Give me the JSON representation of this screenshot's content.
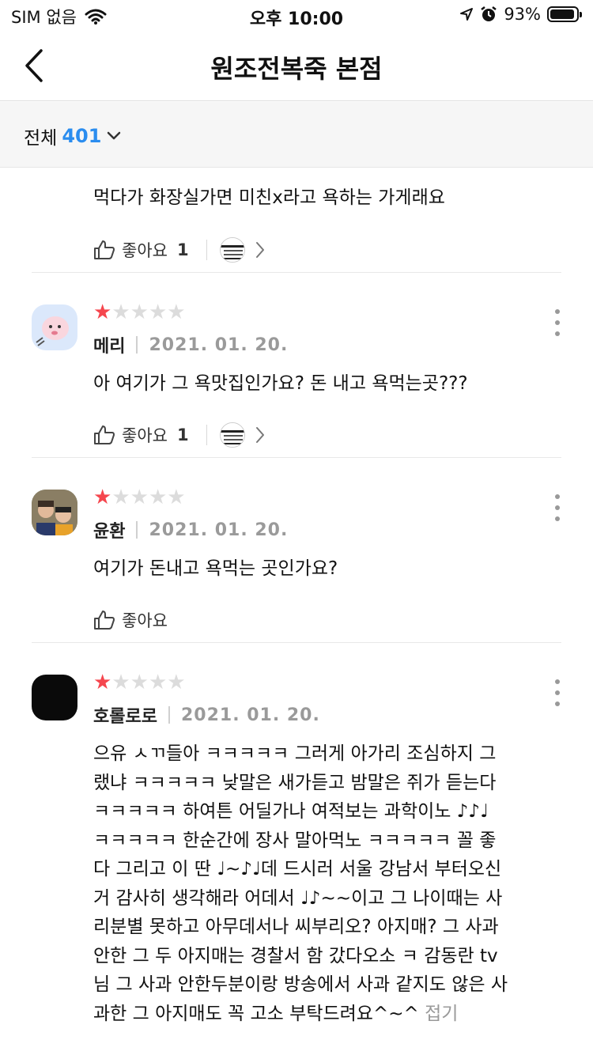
{
  "status_bar": {
    "carrier": "SIM 없음",
    "time": "오후 10:00",
    "battery": "93%",
    "battery_level": 0.93
  },
  "header": {
    "title": "원조전복죽 본점"
  },
  "filter": {
    "label": "전체",
    "count": "401"
  },
  "reviews": [
    {
      "text": "먹다가 화장실가면 미친x라고 욕하는 가게래요",
      "like_label": "좋아요",
      "like_count": "1"
    },
    {
      "rating": 1,
      "author": "메리",
      "date": "2021. 01. 20.",
      "text": "아 여기가 그 욕맛집인가요? 돈 내고 욕먹는곳???",
      "like_label": "좋아요",
      "like_count": "1"
    },
    {
      "rating": 1,
      "author": "윤환",
      "date": "2021. 01. 20.",
      "text": "여기가 돈내고 욕먹는 곳인가요?",
      "like_label": "좋아요",
      "like_count": ""
    },
    {
      "rating": 1,
      "author": "호롤로로",
      "date": "2021. 01. 20.",
      "text_lines": [
        "으유 ㅅㄲ들아 ㅋㅋㅋㅋㅋ 그러게 아가리 조심하지 그",
        "랬냐 ㅋㅋㅋㅋㅋ 낮말은 새가듣고 밤말은 쥐가 듣는다",
        "ㅋㅋㅋㅋㅋ 하여튼 어딜가나 여적보는 과학이노 ♪♪♩",
        "ㅋㅋㅋㅋㅋ 한순간에 장사 말아먹노 ㅋㅋㅋㅋㅋ 꼴 좋",
        "다 그리고 이 딴 ♩~♪♩데 드시러 서울 강남서 부터오신",
        "거 감사히 생각해라 어데서 ♩♪~~이고 그 나이때는 사",
        "리분별 못하고 아무데서나 씨부리오? 아지매? 그 사과",
        "안한 그 두 아지매는 경찰서 함 갔다오소 ㅋ 감동란 tv",
        "님 그 사과 안한두분이랑 방송에서 사과 같지도 않은 사",
        "과한 그 아지매도 꼭 고소 부탁드려요^~^"
      ],
      "collapse_label": "접기"
    }
  ],
  "colors": {
    "accent_blue": "#2b8def",
    "star_on": "#f5464e",
    "star_off": "#dcdcdc"
  },
  "icons": [
    "back-chevron-icon",
    "chevron-down-icon",
    "thumbs-up-icon",
    "chevron-right-icon",
    "kebab-menu-icon",
    "wifi-icon",
    "location-icon",
    "alarm-icon"
  ]
}
